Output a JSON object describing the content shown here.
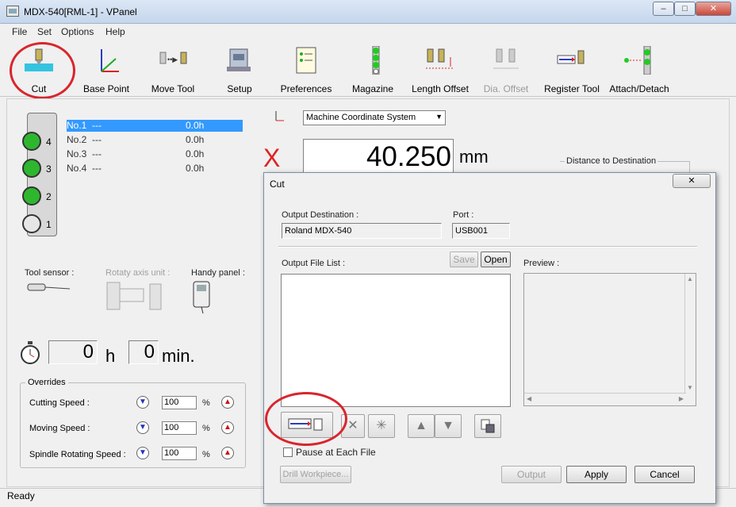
{
  "window": {
    "title": "MDX-540[RML-1] - VPanel"
  },
  "menu": [
    "File",
    "Set",
    "Options",
    "Help"
  ],
  "toolbar": [
    {
      "label": "Cut",
      "icon": "cut-icon",
      "enabled": true
    },
    {
      "label": "Base Point",
      "icon": "base-point-icon",
      "enabled": true
    },
    {
      "label": "Move Tool",
      "icon": "move-tool-icon",
      "enabled": true
    },
    {
      "label": "Setup",
      "icon": "setup-icon",
      "enabled": true
    },
    {
      "label": "Preferences",
      "icon": "preferences-icon",
      "enabled": true
    },
    {
      "label": "Magazine",
      "icon": "magazine-icon",
      "enabled": true
    },
    {
      "label": "Length Offset",
      "icon": "length-offset-icon",
      "enabled": true
    },
    {
      "label": "Dia. Offset",
      "icon": "dia-offset-icon",
      "enabled": false
    },
    {
      "label": "Register Tool",
      "icon": "register-tool-icon",
      "enabled": true
    },
    {
      "label": "Attach/Detach",
      "icon": "attach-detach-icon",
      "enabled": true
    }
  ],
  "magazine": {
    "lamps": [
      "4",
      "3",
      "2",
      "1"
    ],
    "tools": [
      {
        "name": "No.1",
        "dash": "---",
        "value": "0.0h"
      },
      {
        "name": "No.2",
        "dash": "---",
        "value": "0.0h"
      },
      {
        "name": "No.3",
        "dash": "---",
        "value": "0.0h"
      },
      {
        "name": "No.4",
        "dash": "---",
        "value": "0.0h"
      }
    ]
  },
  "coordinate": {
    "system": "Machine Coordinate System",
    "axis": "X",
    "x_value": "40.250",
    "unit": "mm",
    "distance_label": "Distance to Destination"
  },
  "devices": {
    "tool_sensor": "Tool sensor :",
    "rotary": "Rotaty axis unit :",
    "handy": "Handy panel :"
  },
  "timer": {
    "hours": "0",
    "h": "h",
    "minutes": "0",
    "min": "min."
  },
  "overrides": {
    "legend": "Overrides",
    "rows": [
      {
        "label": "Cutting Speed :",
        "value": "100",
        "pct": "%"
      },
      {
        "label": "Moving Speed :",
        "value": "100",
        "pct": "%"
      },
      {
        "label": "Spindle Rotating Speed :",
        "value": "100",
        "pct": "%"
      }
    ]
  },
  "status": "Ready",
  "dialog": {
    "title": "Cut",
    "output_destination_label": "Output Destination :",
    "output_destination": "Roland MDX-540",
    "port_label": "Port :",
    "port": "USB001",
    "file_list_label": "Output File List :",
    "save": "Save",
    "open": "Open",
    "preview_label": "Preview :",
    "pause_label": "Pause at Each File",
    "drill": "Drill Workpiece...",
    "output": "Output",
    "apply": "Apply",
    "cancel": "Cancel"
  }
}
